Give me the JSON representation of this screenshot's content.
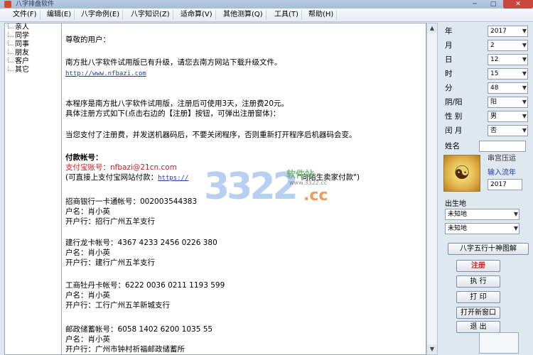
{
  "window": {
    "title": "八字排盘软件",
    "min": "─",
    "max": "□",
    "close": "✕"
  },
  "menu": [
    {
      "label": "文件(F)"
    },
    {
      "label": "编辑(E)"
    },
    {
      "label": "八字命例(E)"
    },
    {
      "label": "八字知识(Z)"
    },
    {
      "label": "适命算(V)"
    },
    {
      "label": "其他测算(Q)"
    },
    {
      "label": "工具(T)"
    },
    {
      "label": "帮助(H)"
    }
  ],
  "tree": [
    "亲人",
    "同学",
    "同事",
    "朋友",
    "客户",
    "其它"
  ],
  "doc": {
    "greeting": "尊敬的用户：",
    "upgrade": "南方批八字软件试用版已有升级，请您去南方网站下载升级文件。",
    "url": "http://www.nfbazi.com",
    "trial1": "本程序是南方批八字软件试用版，注册后可使用3天，注册费20元。",
    "trial2": "具体注册方式如下(点击右边的【注册】按钮，可弹出注册窗体)：",
    "after_pay": "当您支付了注册费，并发送机器码后，不要关闭程序，否则重新打开程序后机器码会变。",
    "pay_title": "付款帐号：",
    "alipay": "支付宝账号：nfbazi@21cn.com",
    "alipay_alt_prefix": "(可直接上支付宝网站付款：",
    "alipay_alt_link": "https://",
    "alipay_alt_suffix": "\"向陌生卖家付款\")",
    "cmb_acct": "招商银行一卡通帐号：00200354438​3",
    "cmb_name": "户名：肖小英",
    "cmb_bank": "开户行：招行广州五羊支行",
    "ccb_acct": "建行龙卡帐号：4367 4233 2456 0226 380",
    "ccb_name": "户名：肖小英",
    "ccb_bank": "开户行：建行广州五羊支行",
    "icbc_acct": "工商牡丹卡帐号：6222 0036 0211 1193 599",
    "icbc_name": "户名：肖小英",
    "icbc_bank": "开户行：工行广州五羊新城支行",
    "post_acct": "邮政储蓄帐号：6058 1402 6200 1035 55",
    "post_name": "户名：肖小英",
    "post_bank": "开户行：广州市钟村祈福邮政储蓄所"
  },
  "watermark": {
    "num": "3322",
    "cc": ".cc",
    "site": "软件站",
    "sub": "www.3322.cc"
  },
  "panel": {
    "rows": [
      {
        "label": "年",
        "value": "2017"
      },
      {
        "label": "月",
        "value": "2"
      },
      {
        "label": "日",
        "value": "12"
      },
      {
        "label": "时",
        "value": "15"
      },
      {
        "label": "分",
        "value": "48"
      },
      {
        "label": "阴/阳",
        "value": "阳"
      },
      {
        "label": "性 别",
        "value": "男"
      },
      {
        "label": "闰 月",
        "value": "否"
      }
    ],
    "name_label": "姓名",
    "right_label1": "串宫压运",
    "right_label2": "输入流年",
    "liunian_year": "2017",
    "birthplace_label": "出生地",
    "place1": "未知地",
    "place2": "未知地",
    "buttons": {
      "bazi": "八字五行十神图解",
      "register": "注册",
      "execute": "执 行",
      "print": "打 印",
      "new_window": "打开新窗口",
      "exit": "退 出"
    }
  }
}
